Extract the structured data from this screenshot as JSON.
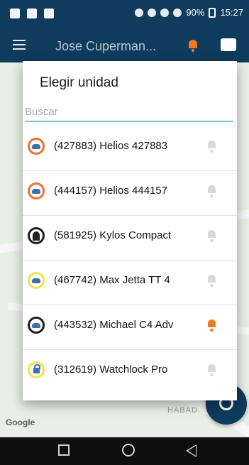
{
  "status_bar": {
    "battery": "90%",
    "time": "15:27"
  },
  "app_bar": {
    "title": "Jose Cuperman...",
    "accent": "#f07a24",
    "bg": "#0f3b5c"
  },
  "dialog": {
    "title": "Elegir unidad",
    "search_placeholder": "Buscar",
    "items": [
      {
        "label": "(427883) Helios 427883",
        "badge_color": "#e9742b",
        "icon": "car-icon",
        "alert_active": false
      },
      {
        "label": "(444157) Helios 444157",
        "badge_color": "#e9742b",
        "icon": "car-icon",
        "alert_active": false
      },
      {
        "label": "(581925) Kylos Compact",
        "badge_color": "#1f1f1f",
        "icon": "person-icon",
        "alert_active": false
      },
      {
        "label": "(467742) Max Jetta TT 4",
        "badge_color": "#f0e34a",
        "icon": "car-icon",
        "alert_active": false
      },
      {
        "label": "(443532) Michael C4 Adv",
        "badge_color": "#1f1f1f",
        "icon": "car-icon",
        "alert_active": true
      },
      {
        "label": "(312619) Watchlock Pro",
        "badge_color": "#f0e34a",
        "icon": "lock-icon",
        "alert_active": false
      }
    ]
  },
  "map": {
    "attribution": "Google",
    "place_label": "HABAD"
  }
}
